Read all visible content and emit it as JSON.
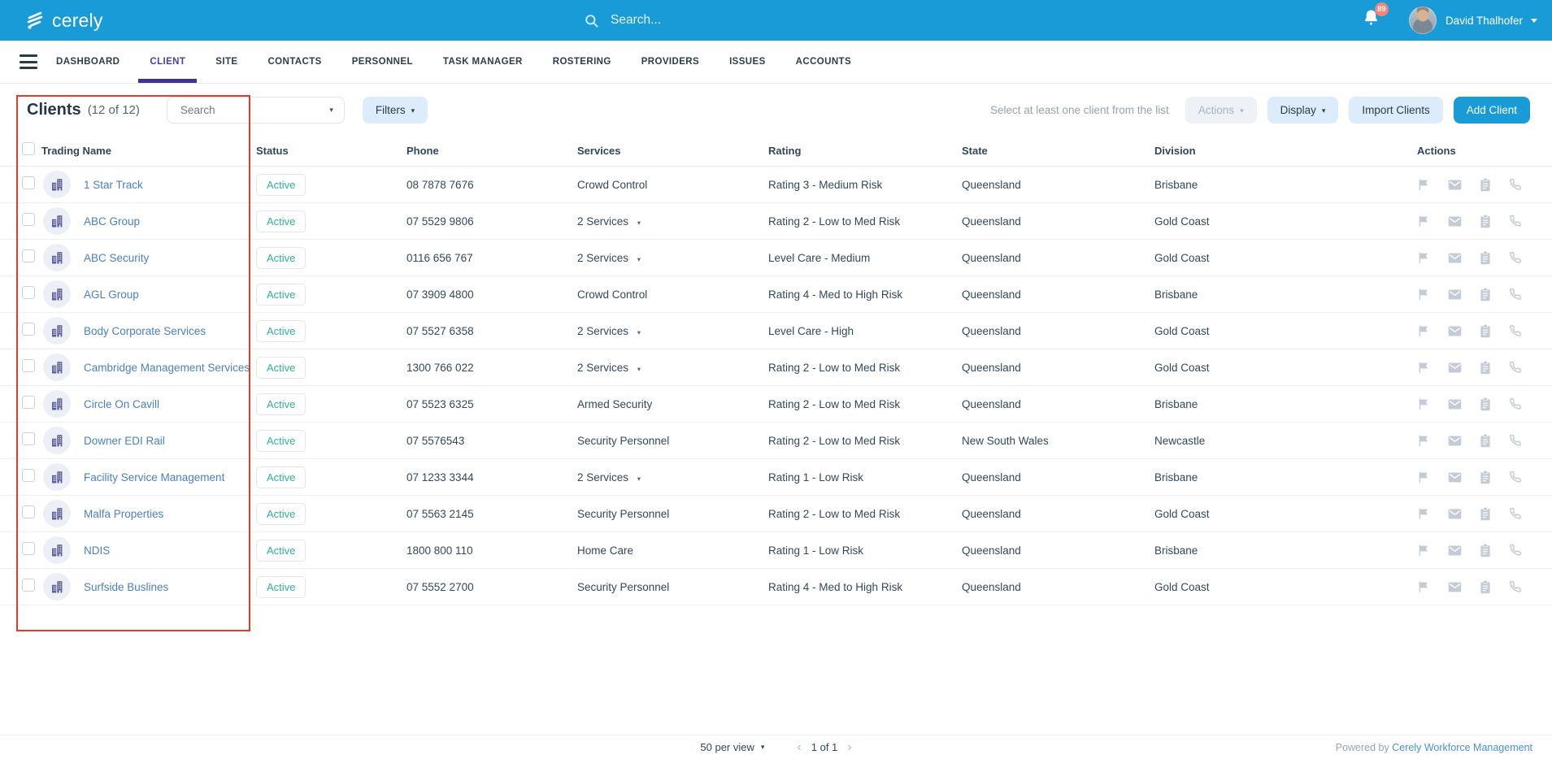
{
  "header": {
    "logo_text": "cerely",
    "search_placeholder": "Search...",
    "notification_count": "89",
    "user_name": "David Thalhofer"
  },
  "nav": {
    "items": [
      {
        "label": "DASHBOARD",
        "active": false
      },
      {
        "label": "CLIENT",
        "active": true
      },
      {
        "label": "SITE",
        "active": false
      },
      {
        "label": "CONTACTS",
        "active": false
      },
      {
        "label": "PERSONNEL",
        "active": false
      },
      {
        "label": "TASK MANAGER",
        "active": false
      },
      {
        "label": "ROSTERING",
        "active": false
      },
      {
        "label": "PROVIDERS",
        "active": false
      },
      {
        "label": "ISSUES",
        "active": false
      },
      {
        "label": "ACCOUNTS",
        "active": false
      }
    ]
  },
  "toolbar": {
    "title": "Clients",
    "count": "(12 of 12)",
    "search_placeholder": "Search",
    "filters_label": "Filters",
    "hint": "Select at least one client from the list",
    "actions_label": "Actions",
    "display_label": "Display",
    "import_label": "Import Clients",
    "add_label": "Add Client"
  },
  "table": {
    "columns": [
      "Trading Name",
      "Status",
      "Phone",
      "Services",
      "Rating",
      "State",
      "Division",
      "Actions"
    ],
    "rows": [
      {
        "name": "1 Star Track",
        "status": "Active",
        "phone": "08 7878 7676",
        "services": "Crowd Control",
        "services_dropdown": false,
        "rating": "Rating 3 - Medium Risk",
        "state": "Queensland",
        "division": "Brisbane"
      },
      {
        "name": "ABC Group",
        "status": "Active",
        "phone": "07 5529 9806",
        "services": "2 Services",
        "services_dropdown": true,
        "rating": "Rating 2 - Low to Med Risk",
        "state": "Queensland",
        "division": "Gold Coast"
      },
      {
        "name": "ABC Security",
        "status": "Active",
        "phone": "0116 656 767",
        "services": "2 Services",
        "services_dropdown": true,
        "rating": "Level Care - Medium",
        "state": "Queensland",
        "division": "Gold Coast"
      },
      {
        "name": "AGL Group",
        "status": "Active",
        "phone": "07 3909 4800",
        "services": "Crowd Control",
        "services_dropdown": false,
        "rating": "Rating 4 - Med to High Risk",
        "state": "Queensland",
        "division": "Brisbane"
      },
      {
        "name": "Body Corporate Services",
        "status": "Active",
        "phone": "07 5527 6358",
        "services": "2 Services",
        "services_dropdown": true,
        "rating": "Level Care - High",
        "state": "Queensland",
        "division": "Gold Coast"
      },
      {
        "name": "Cambridge Management Services",
        "status": "Active",
        "phone": "1300 766 022",
        "services": "2 Services",
        "services_dropdown": true,
        "rating": "Rating 2 - Low to Med Risk",
        "state": "Queensland",
        "division": "Gold Coast"
      },
      {
        "name": "Circle On Cavill",
        "status": "Active",
        "phone": "07 5523 6325",
        "services": "Armed Security",
        "services_dropdown": false,
        "rating": "Rating 2 - Low to Med Risk",
        "state": "Queensland",
        "division": "Brisbane"
      },
      {
        "name": "Downer EDI Rail",
        "status": "Active",
        "phone": "07 5576543",
        "services": "Security Personnel",
        "services_dropdown": false,
        "rating": "Rating 2 - Low to Med Risk",
        "state": "New South Wales",
        "division": "Newcastle"
      },
      {
        "name": "Facility Service Management",
        "status": "Active",
        "phone": "07 1233 3344",
        "services": "2 Services",
        "services_dropdown": true,
        "rating": "Rating 1 - Low Risk",
        "state": "Queensland",
        "division": "Brisbane"
      },
      {
        "name": "Malfa Properties",
        "status": "Active",
        "phone": "07 5563 2145",
        "services": "Security Personnel",
        "services_dropdown": false,
        "rating": "Rating 2 - Low to Med Risk",
        "state": "Queensland",
        "division": "Gold Coast"
      },
      {
        "name": "NDIS",
        "status": "Active",
        "phone": "1800 800 110",
        "services": "Home Care",
        "services_dropdown": false,
        "rating": "Rating 1 - Low Risk",
        "state": "Queensland",
        "division": "Brisbane"
      },
      {
        "name": "Surfside Buslines",
        "status": "Active",
        "phone": "07 5552 2700",
        "services": "Security Personnel",
        "services_dropdown": false,
        "rating": "Rating 4 - Med to High Risk",
        "state": "Queensland",
        "division": "Gold Coast"
      }
    ]
  },
  "footer": {
    "per_page": "50 per view",
    "page_indicator": "1 of 1",
    "powered_prefix": "Powered by",
    "powered_link": "Cerely Workforce Management"
  },
  "colors": {
    "topbar_blue": "#189bd7",
    "primary_button_blue": "#189bd7",
    "nav_active_purple": "#4a3fa5",
    "nav_underline": "#3e3192",
    "link_blue": "#4a80c2",
    "status_active_green": "#2eb398",
    "light_button_bg": "#ddecfa",
    "notification_badge": "#f4837a",
    "annotation_red": "#e23b2c"
  }
}
